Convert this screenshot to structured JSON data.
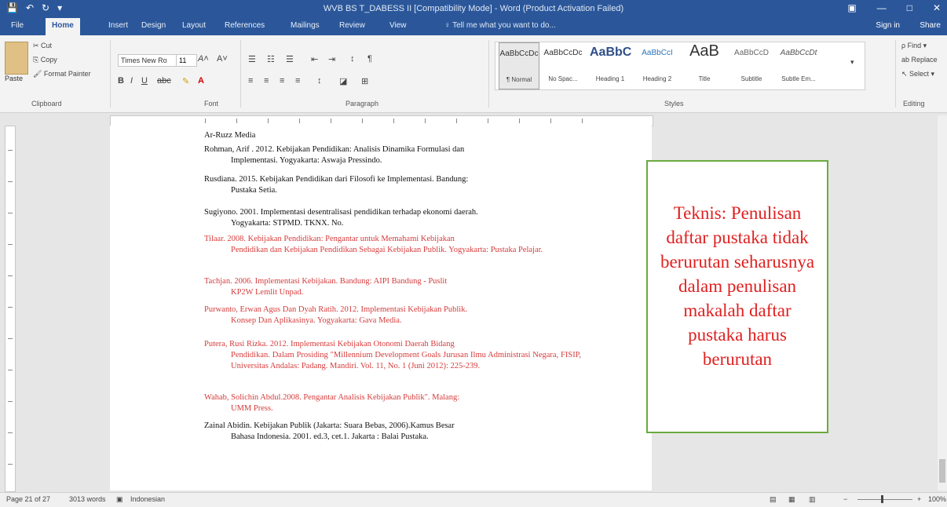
{
  "titlebar": {
    "title": "WVB BS T_DABESS II [Compatibility Mode] - Word (Product Activation Failed)",
    "quick": [
      "💾",
      "↶",
      "↻",
      "▾"
    ],
    "window_controls": [
      "▣",
      "—",
      "□",
      "✕"
    ]
  },
  "tabs": [
    "File",
    "Home",
    "Insert",
    "Design",
    "Layout",
    "References",
    "Mailings",
    "Review",
    "View"
  ],
  "tellme": "♀ Tell me what you want to do...",
  "signin": "Sign in",
  "share": "Share",
  "clipboard": {
    "paste": "Paste",
    "items": [
      "✂ Cut",
      "⎘ Copy",
      "🖌 Format Painter"
    ],
    "label": "Clipboard"
  },
  "font": {
    "name": "Times New Ro",
    "size": "11",
    "label": "Font"
  },
  "paragraph": {
    "label": "Paragraph"
  },
  "styles": {
    "label": "Styles",
    "items": [
      {
        "sample": "AaBbCcDc",
        "name": "¶ Normal"
      },
      {
        "sample": "AaBbCcDc",
        "name": "No Spac..."
      },
      {
        "sample": "AaBbC",
        "name": "Heading 1"
      },
      {
        "sample": "AaBbCcI",
        "name": "Heading 2"
      },
      {
        "sample": "AaB",
        "name": "Title"
      },
      {
        "sample": "AaBbCcD",
        "name": "Subtitle"
      },
      {
        "sample": "AaBbCcDt",
        "name": "Subtle Em..."
      }
    ]
  },
  "editing": {
    "label": "Editing",
    "items": [
      "ρ Find ▾",
      "ab Replace",
      "↖ Select ▾"
    ]
  },
  "references": [
    {
      "l1": "Ar-Ruzz Media",
      "l2": "",
      "red": false
    },
    {
      "l1": "Rohman, Arif . 2012. Kebijakan Pendidikan: Analisis Dinamika Formulasi dan",
      "l2": "Implementasi. Yogyakarta: Aswaja Pressindo.",
      "red": false
    },
    {
      "l1": "Rusdiana. 2015. Kebijakan Pendidikan dari Filosofi ke Implementasi. Bandung:",
      "l2": "Pustaka Setia.",
      "red": false
    },
    {
      "l1": "Sugiyono. 2001. Implementasi desentralisasi pendidikan terhadap ekonomi daerah.",
      "l2": "Yogyakarta: STPMD. TKNX. No.",
      "red": false
    },
    {
      "l1": "Tilaar. 2008. Kebijakan Pendidikan: Pengantar untuk Memahami Kebijakan",
      "l2": "Pendidikan dan Kebijakan Pendidikan Sebagai Kebijakan Publik. Yogyakarta: Pustaka Pelajar.",
      "red": true
    },
    {
      "l1": "Tachjan. 2006. Implementasi Kebijakan. Bandung: AIPI Bandung - Puslit",
      "l2": "KP2W Lemlit Unpad.",
      "red": true
    },
    {
      "l1": "Purwanto, Erwan Agus Dan Dyah Ratih. 2012. Implementasi Kebijakan Publik.",
      "l2": "Konsep Dan Aplikasinya. Yogyakarta: Gava Media.",
      "red": true
    },
    {
      "l1": "Putera, Rusi Rizka. 2012. Implementasi Kebijakan Otonomi Daerah Bidang",
      "l2": "Pendidikan. Dalam Prosiding \"Millennium Development Goals Jurusan Ilmu Administrasi Negara, FISIP, Universitas Andalas: Padang. Mandiri. Vol. 11, No. 1 (Juni 2012): 225-239.",
      "red": true
    },
    {
      "l1": "Wahab, Solichin Abdul.2008. Pengantar Analisis Kebijakan Publik\". Malang:",
      "l2": "UMM Press.",
      "red": true
    },
    {
      "l1": "Zainal Abidin. Kebijakan Publik (Jakarta: Suara Bebas, 2006).Kamus Besar",
      "l2": "Bahasa Indonesia. 2001. ed.3, cet.1. Jakarta : Balai Pustaka.",
      "red": false
    }
  ],
  "comment": {
    "text": "Teknis: Penulisan daftar pustaka tidak berurutan seharusnya dalam penulisan makalah daftar pustaka harus berurutan",
    "color": "#e02020",
    "border": "#6aaa3f"
  },
  "status": {
    "page": "Page 21 of 27",
    "words": "3013 words",
    "lang": "Indonesian",
    "zoom": "100%"
  },
  "colors": {
    "accent": "#2b579a",
    "red_text": "#d63b3b"
  }
}
